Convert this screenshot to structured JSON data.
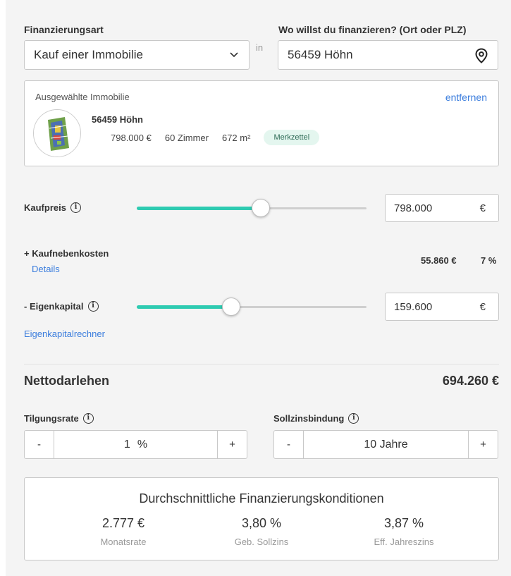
{
  "financing": {
    "type_label": "Finanzierungsart",
    "type_value": "Kauf einer Immobilie",
    "in_text": "in",
    "location_label": "Wo willst du finanzieren? (Ort oder PLZ)",
    "location_value": "56459 Höhn"
  },
  "property": {
    "heading": "Ausgewählte Immobilie",
    "remove_label": "entfernen",
    "title": "56459 Höhn",
    "price": "798.000 €",
    "rooms": "60 Zimmer",
    "area": "672 m²",
    "badge": "Merkzettel"
  },
  "kaufpreis": {
    "label": "Kaufpreis",
    "value": "798.000",
    "currency": "€",
    "slider_fraction": 0.54
  },
  "nebenkosten": {
    "label": "+ Kaufnebenkosten",
    "details_link": "Details",
    "amount": "55.860 €",
    "percent": "7 %"
  },
  "eigenkapital": {
    "label": "- Eigenkapital",
    "value": "159.600",
    "currency": "€",
    "slider_fraction": 0.41,
    "calculator_link": "Eigenkapitalrechner"
  },
  "netto": {
    "label": "Nettodarlehen",
    "value": "694.260 €"
  },
  "tilgung": {
    "label": "Tilgungsrate",
    "value": "1",
    "unit": "%",
    "minus": "-",
    "plus": "+"
  },
  "sollzins": {
    "label": "Sollzinsbindung",
    "value": "10 Jahre",
    "minus": "-",
    "plus": "+"
  },
  "conditions": {
    "title": "Durchschnittliche Finanzierungskonditionen",
    "items": [
      {
        "value": "2.777 €",
        "label": "Monatsrate"
      },
      {
        "value": "3,80 %",
        "label": "Geb. Sollzins"
      },
      {
        "value": "3,87 %",
        "label": "Eff. Jahreszins"
      }
    ]
  },
  "colors": {
    "accent": "#2ecbb1",
    "link": "#3b7ddd",
    "badge_bg": "#e4f6ef"
  }
}
